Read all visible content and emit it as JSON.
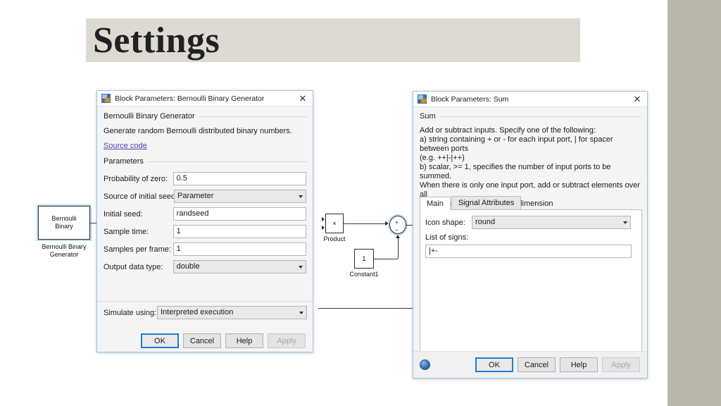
{
  "slide": {
    "title": "Settings",
    "banner_color": "#dcdad2",
    "side_band_color": "#b8b7ad"
  },
  "canvas": {
    "blocks": [
      {
        "name": "bernoulli",
        "text": "Bernoulli\nBinary",
        "label": "Bernoulli Binary\nGenerator"
      },
      {
        "name": "product",
        "text": "×",
        "label": "Product"
      },
      {
        "name": "constant1",
        "text": "1",
        "label": "Constant1"
      }
    ],
    "sum_block": {
      "plus": "+",
      "minus": "−"
    }
  },
  "bernoulli_dialog": {
    "title": "Block Parameters: Bernoulli Binary Generator",
    "icon": "simulink-block-icon",
    "close_label": "✕",
    "header": "Bernoulli Binary Generator",
    "description": "Generate random Bernoulli distributed binary numbers.",
    "source_link": "Source code",
    "group_label": "Parameters",
    "fields": [
      {
        "label": "Probability of zero:",
        "value": "0.5",
        "type": "text"
      },
      {
        "label": "Source of initial seed:",
        "value": "Parameter",
        "type": "combo"
      },
      {
        "label": "Initial seed:",
        "value": "randseed",
        "type": "text"
      },
      {
        "label": "Sample time:",
        "value": "1",
        "type": "text"
      },
      {
        "label": "Samples per frame:",
        "value": "1",
        "type": "text"
      },
      {
        "label": "Output data type:",
        "value": "double",
        "type": "combo"
      }
    ],
    "simulate_label": "Simulate using:",
    "simulate_value": "Interpreted execution",
    "buttons": [
      {
        "label": "OK",
        "style": "default"
      },
      {
        "label": "Cancel",
        "style": "normal"
      },
      {
        "label": "Help",
        "style": "normal"
      },
      {
        "label": "Apply",
        "style": "disabled"
      }
    ]
  },
  "sum_dialog": {
    "title": "Block Parameters: Sum",
    "icon": "simulink-block-icon",
    "close_label": "✕",
    "header": "Sum",
    "description_lines": [
      "Add or subtract inputs.  Specify one of the following:",
      "a) string containing + or - for each input port, | for spacer between ports",
      "(e.g. ++|-|++)",
      "b) scalar, >= 1, specifies the number of input ports to be summed.",
      "When there is only one input port, add or subtract elements over all",
      "dimensions or one specified dimension"
    ],
    "tabs": [
      {
        "label": "Main",
        "active": true
      },
      {
        "label": "Signal Attributes",
        "active": false
      }
    ],
    "icon_shape_label": "Icon shape:",
    "icon_shape_value": "round",
    "signs_label": "List of signs:",
    "signs_value": "|+-",
    "help_icon": "help-circle-icon",
    "buttons": [
      {
        "label": "OK",
        "style": "default"
      },
      {
        "label": "Cancel",
        "style": "normal"
      },
      {
        "label": "Help",
        "style": "normal"
      },
      {
        "label": "Apply",
        "style": "disabled"
      }
    ]
  }
}
